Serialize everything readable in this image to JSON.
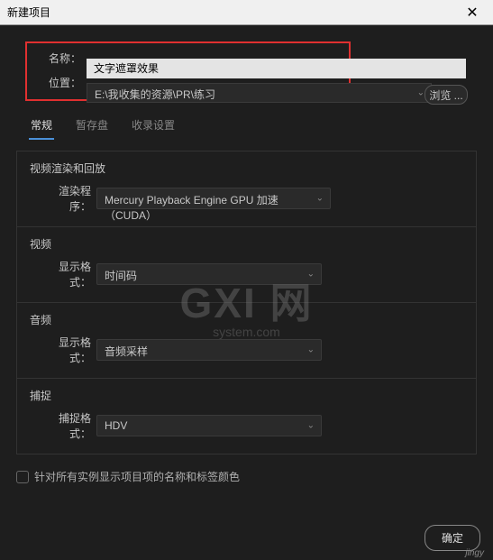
{
  "window": {
    "title": "新建项目"
  },
  "form": {
    "name_label": "名称：",
    "name_value": "文字遮罩效果",
    "location_label": "位置：",
    "location_value": "E:\\我收集的资源\\PR\\练习",
    "browse_label": "浏览 ..."
  },
  "tabs": {
    "general": "常规",
    "scratch": "暂存盘",
    "ingest": "收录设置"
  },
  "sections": {
    "render": {
      "title": "视频渲染和回放",
      "renderer_label": "渲染程序：",
      "renderer_value": "Mercury Playback Engine GPU 加速（CUDA）"
    },
    "video": {
      "title": "视频",
      "display_label": "显示格式：",
      "display_value": "时间码"
    },
    "audio": {
      "title": "音频",
      "display_label": "显示格式：",
      "display_value": "音频采样"
    },
    "capture": {
      "title": "捕捉",
      "format_label": "捕捉格式：",
      "format_value": "HDV"
    }
  },
  "checkbox": {
    "label": "针对所有实例显示项目项的名称和标签颜色"
  },
  "footer": {
    "ok_label": "确定"
  },
  "watermark": {
    "line1": "GXI 网",
    "line2": "system.com",
    "corner": "jingy"
  }
}
